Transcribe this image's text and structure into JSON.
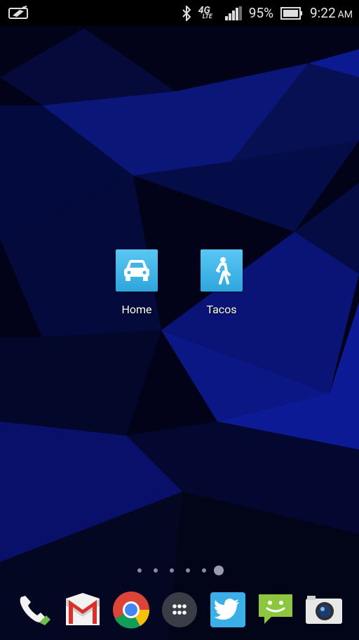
{
  "status_bar": {
    "battery_percent": "95%",
    "time": "9:22",
    "ampm": "AM",
    "network": "4G",
    "network_sub": "LTE",
    "icons": [
      "notification-icon",
      "bluetooth-icon",
      "lte-icon",
      "signal-icon",
      "battery-icon"
    ]
  },
  "home_screen": {
    "shortcuts": [
      {
        "label": "Home",
        "icon": "car-icon"
      },
      {
        "label": "Tacos",
        "icon": "walking-icon"
      }
    ],
    "page_count": 6,
    "active_page": 6
  },
  "dock": {
    "apps": [
      "phone-icon",
      "gmail-icon",
      "chrome-icon",
      "app-drawer-icon",
      "twitter-icon",
      "messaging-icon",
      "camera-icon"
    ]
  },
  "colors": {
    "tile_blue": "#3fb4e8",
    "wallpaper_dark": "#02031a",
    "wallpaper_blue": "#0a1585"
  }
}
